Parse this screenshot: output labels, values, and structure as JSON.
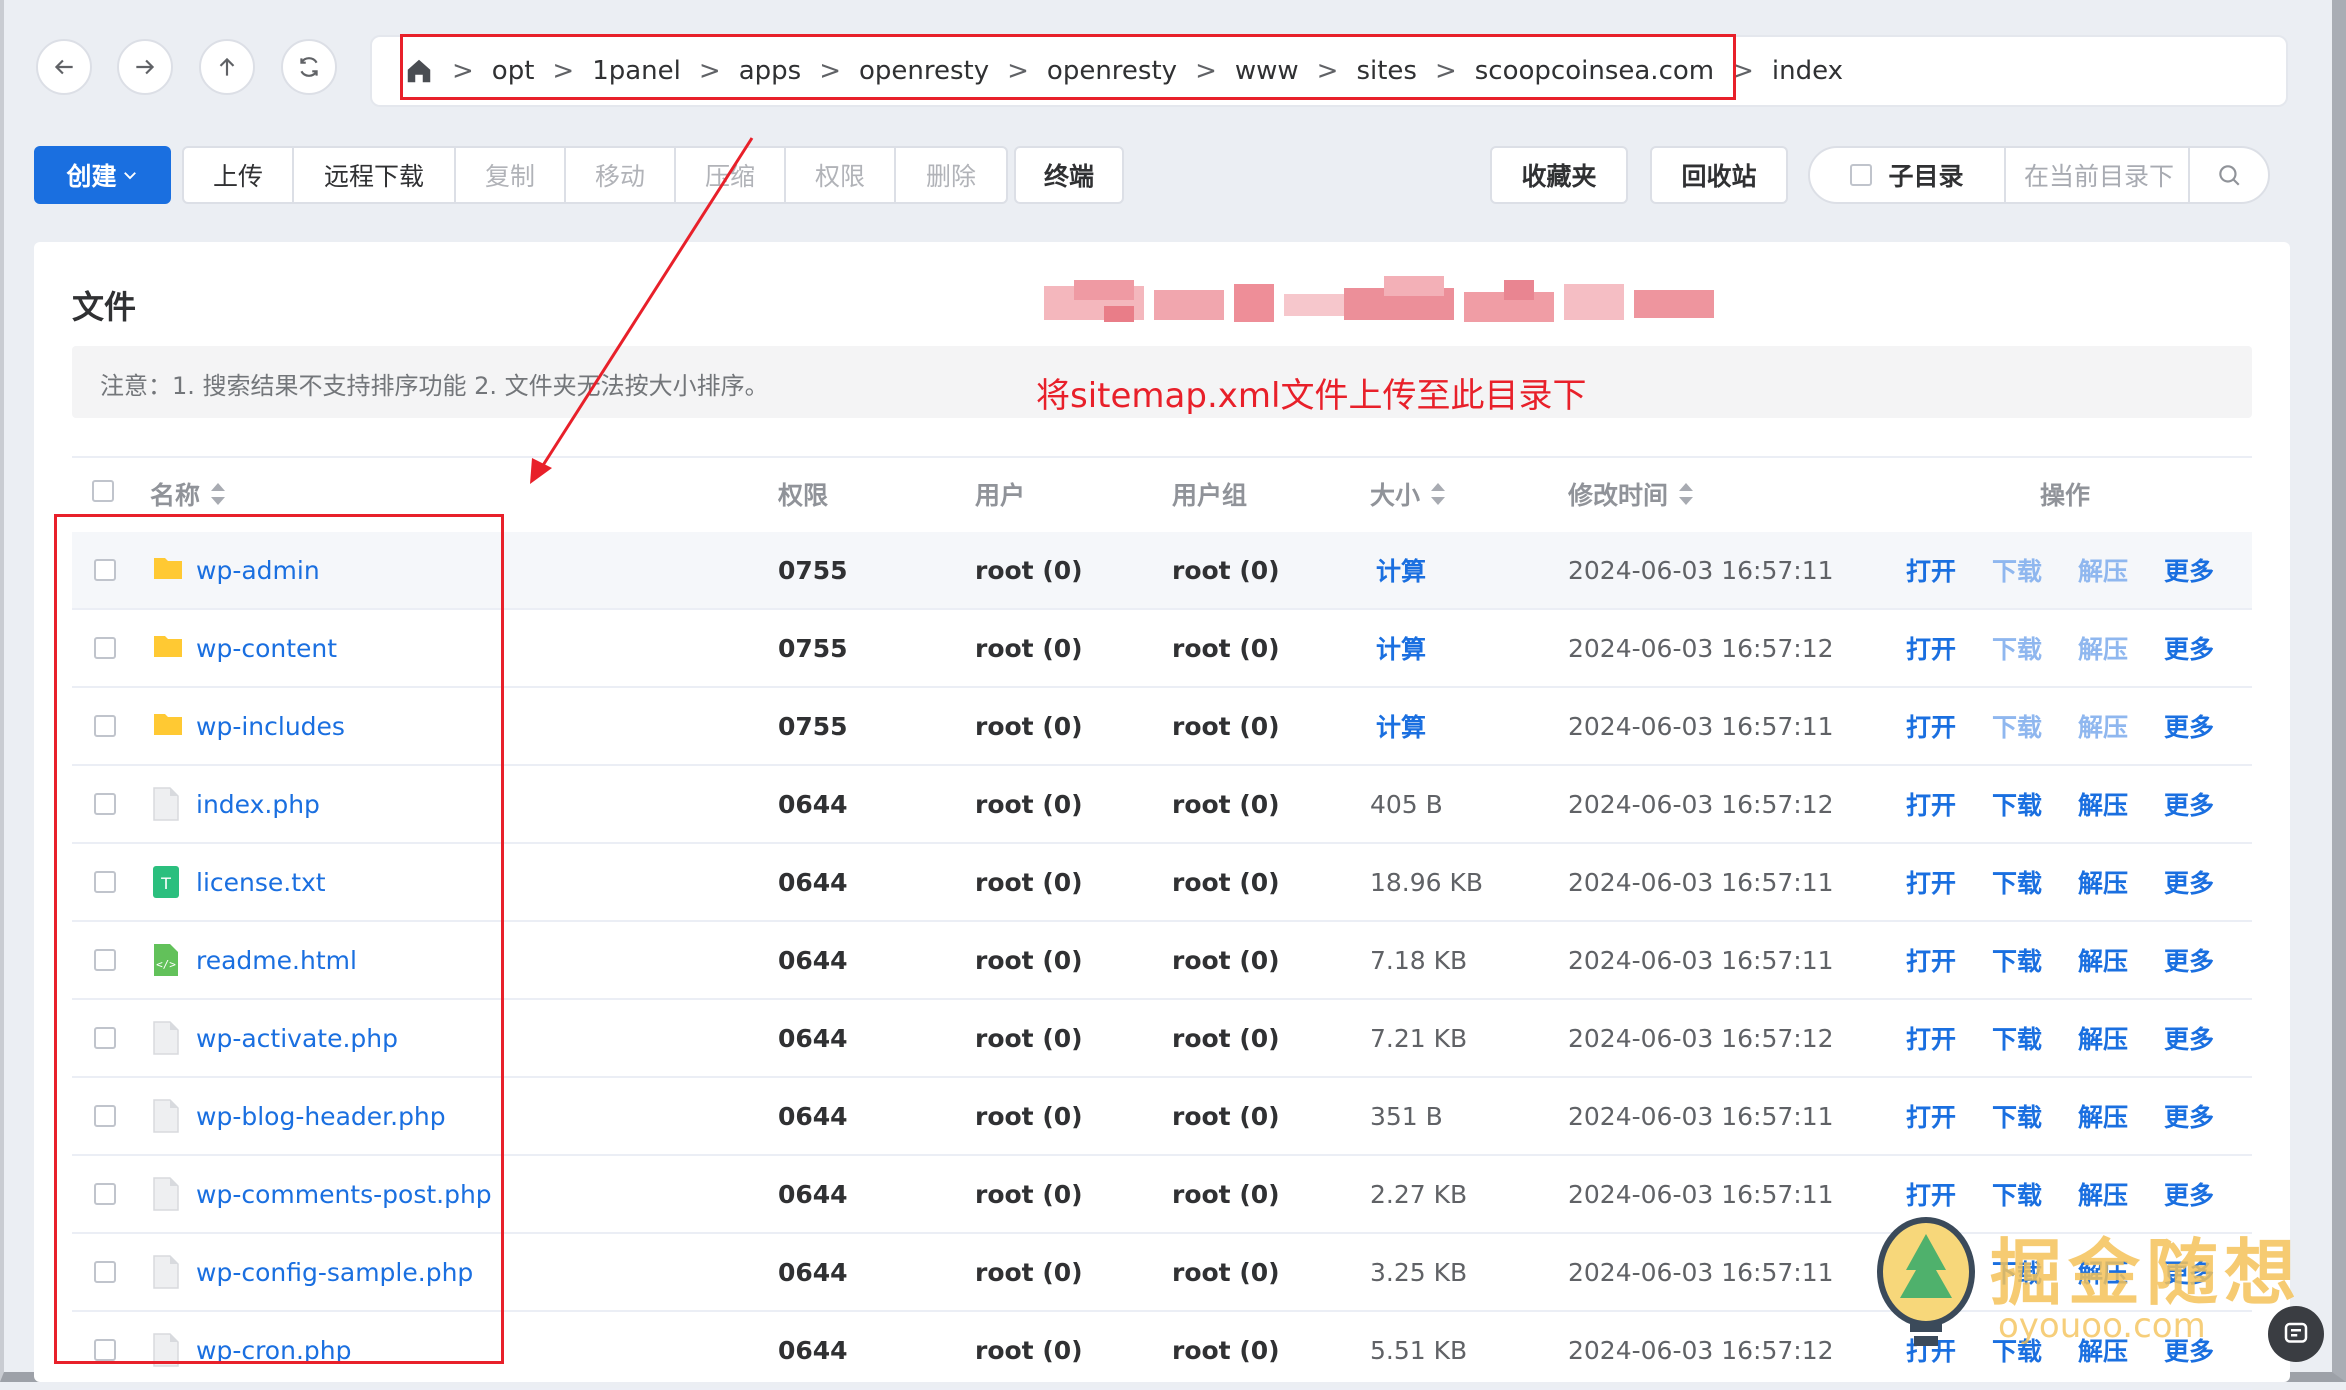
{
  "nav": {
    "back": "back",
    "forward": "forward",
    "up": "up",
    "refresh": "refresh"
  },
  "breadcrumb": {
    "separator": ">",
    "items": [
      "opt",
      "1panel",
      "apps",
      "openresty",
      "openresty",
      "www",
      "sites",
      "scoopcoinsea.com",
      "index"
    ]
  },
  "toolbar": {
    "create": "创建",
    "group": [
      {
        "label": "上传",
        "enabled": true
      },
      {
        "label": "远程下载",
        "enabled": true
      },
      {
        "label": "复制",
        "enabled": false
      },
      {
        "label": "移动",
        "enabled": false
      },
      {
        "label": "压缩",
        "enabled": false
      },
      {
        "label": "权限",
        "enabled": false
      },
      {
        "label": "删除",
        "enabled": false
      }
    ],
    "terminal": "终端",
    "favorites": "收藏夹",
    "recycle": "回收站",
    "subdir": "子目录",
    "search_placeholder": "在当前目录下"
  },
  "card": {
    "title": "文件",
    "notice": "注意：1. 搜索结果不支持排序功能 2. 文件夹无法按大小排序。",
    "annotation": "将sitemap.xml文件上传至此目录下"
  },
  "table": {
    "headers": {
      "name": "名称",
      "perm": "权限",
      "user": "用户",
      "group": "用户组",
      "size": "大小",
      "mtime": "修改时间",
      "ops": "操作"
    },
    "actions": {
      "open": "打开",
      "download": "下载",
      "extract": "解压",
      "more": "更多"
    },
    "rows": [
      {
        "name": "wp-admin",
        "type": "folder",
        "perm": "0755",
        "user": "root (0)",
        "group": "root (0)",
        "size": "计算",
        "mtime": "2024-06-03 16:57:11"
      },
      {
        "name": "wp-content",
        "type": "folder",
        "perm": "0755",
        "user": "root (0)",
        "group": "root (0)",
        "size": "计算",
        "mtime": "2024-06-03 16:57:12"
      },
      {
        "name": "wp-includes",
        "type": "folder",
        "perm": "0755",
        "user": "root (0)",
        "group": "root (0)",
        "size": "计算",
        "mtime": "2024-06-03 16:57:11"
      },
      {
        "name": "index.php",
        "type": "file",
        "perm": "0644",
        "user": "root (0)",
        "group": "root (0)",
        "size": "405 B",
        "mtime": "2024-06-03 16:57:12"
      },
      {
        "name": "license.txt",
        "type": "text",
        "perm": "0644",
        "user": "root (0)",
        "group": "root (0)",
        "size": "18.96 KB",
        "mtime": "2024-06-03 16:57:11"
      },
      {
        "name": "readme.html",
        "type": "html",
        "perm": "0644",
        "user": "root (0)",
        "group": "root (0)",
        "size": "7.18 KB",
        "mtime": "2024-06-03 16:57:11"
      },
      {
        "name": "wp-activate.php",
        "type": "file",
        "perm": "0644",
        "user": "root (0)",
        "group": "root (0)",
        "size": "7.21 KB",
        "mtime": "2024-06-03 16:57:12"
      },
      {
        "name": "wp-blog-header.php",
        "type": "file",
        "perm": "0644",
        "user": "root (0)",
        "group": "root (0)",
        "size": "351 B",
        "mtime": "2024-06-03 16:57:11"
      },
      {
        "name": "wp-comments-post.php",
        "type": "file",
        "perm": "0644",
        "user": "root (0)",
        "group": "root (0)",
        "size": "2.27 KB",
        "mtime": "2024-06-03 16:57:11"
      },
      {
        "name": "wp-config-sample.php",
        "type": "file",
        "perm": "0644",
        "user": "root (0)",
        "group": "root (0)",
        "size": "3.25 KB",
        "mtime": "2024-06-03 16:57:11"
      },
      {
        "name": "wp-cron.php",
        "type": "file",
        "perm": "0644",
        "user": "root (0)",
        "group": "root (0)",
        "size": "5.51 KB",
        "mtime": "2024-06-03 16:57:12"
      }
    ]
  },
  "watermark": {
    "text": "掘金随想",
    "url": "oyouoo.com"
  },
  "colors": {
    "primary": "#1a6fe0",
    "annotation_red": "#e8202a",
    "folder": "#ffc933"
  }
}
